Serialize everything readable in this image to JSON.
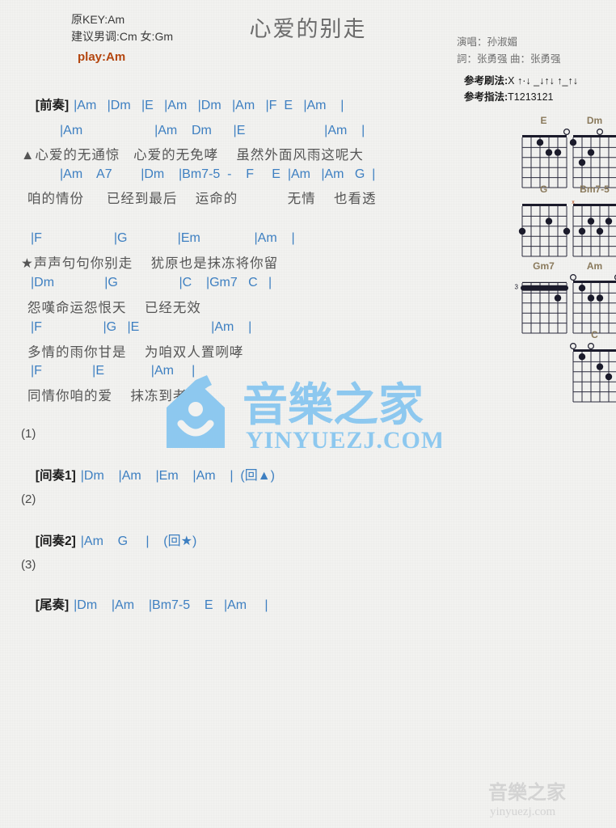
{
  "header": {
    "original_key": "原KEY:Am",
    "suggested_key": "建议男调:Cm 女:Gm",
    "play_key": "play:Am",
    "title": "心爱的别走",
    "singer": "演唱：孙淑媚",
    "writers": "詞：张勇强   曲：张勇强",
    "strum_label": "参考刷法:",
    "strum_value": "X ↑·↓ _↓↑↓ ↑_↑↓",
    "fingerstyle_label": "参考指法:",
    "fingerstyle_value": "T1213121"
  },
  "sections": {
    "intro": {
      "tag": "[前奏]",
      "chords": "|Am   |Dm   |E   |Am   |Dm   |Am   |F  E   |Am    |"
    },
    "verse1": {
      "chord_line_1": "|Am                    |Am    Dm      |E                      |Am    |",
      "lyric_line_1": "▲心爱的无通惊   心爱的无免哮    虽然外面风雨这呢大",
      "chord_line_2": "|Am    A7        |Dm    |Bm7-5  -    F     E  |Am   |Am   G  |",
      "lyric_line_2": "咱的情份     已经到最后    运命的           无情    也看透"
    },
    "chorus": {
      "chord_line_1": "|F                    |G              |Em               |Am    |",
      "lyric_line_1": "★声声句句你别走    犹原也是抹冻将你留",
      "chord_line_2": "|Dm              |G                 |C    |Gm7   C   |",
      "lyric_line_2": "怨嘆命运怨恨天    已经无效",
      "chord_line_3": "|F                 |G   |E                    |Am    |",
      "lyric_line_3": "多情的雨你甘是    为咱双人置咧哮",
      "chord_line_4": "|F              |E             |Am     |",
      "lyric_line_4": "同情你咱的爱    抹冻到老"
    },
    "interlude1": {
      "number": "(1)",
      "tag": "[间奏1]",
      "chords": "|Dm    |Am    |Em    |Am    |  (回▲)"
    },
    "interlude2": {
      "number": "(2)",
      "tag": "[间奏2]",
      "chords": "|Am    G     |    (回★)"
    },
    "outro": {
      "number": "(3)",
      "tag": "[尾奏]",
      "chords": "|Dm    |Am    |Bm7-5    E   |Am     |"
    }
  },
  "chord_diagrams": [
    {
      "name": "E",
      "open": [
        6
      ],
      "muted": [],
      "dots": [
        [
          3,
          1
        ],
        [
          5,
          2
        ],
        [
          4,
          2
        ]
      ],
      "barre": null,
      "fret_label": ""
    },
    {
      "name": "Dm",
      "open": [
        4
      ],
      "muted": [],
      "dots": [
        [
          1,
          1
        ],
        [
          3,
          2
        ],
        [
          2,
          3
        ]
      ],
      "barre": null,
      "fret_label": ""
    },
    {
      "name": "G",
      "open": [],
      "muted": [],
      "dots": [
        [
          4,
          2
        ],
        [
          6,
          3
        ],
        [
          1,
          3
        ]
      ],
      "barre": null,
      "fret_label": ""
    },
    {
      "name": "Bm7-5",
      "open": [],
      "muted": [
        6,
        1
      ],
      "dots": [
        [
          5,
          2
        ],
        [
          3,
          2
        ],
        [
          4,
          3
        ],
        [
          2,
          3
        ]
      ],
      "barre": null,
      "fret_label": ""
    },
    {
      "name": "Gm7",
      "open": [],
      "muted": [],
      "dots": [
        [
          5,
          2
        ]
      ],
      "barre": 1,
      "fret_label": "3"
    },
    {
      "name": "Am",
      "open": [
        6,
        1
      ],
      "muted": [],
      "dots": [
        [
          2,
          1
        ],
        [
          4,
          2
        ],
        [
          3,
          2
        ]
      ],
      "barre": null,
      "fret_label": ""
    },
    {
      "name": "C",
      "open": [
        3,
        1
      ],
      "muted": [
        6
      ],
      "dots": [
        [
          2,
          1
        ],
        [
          4,
          2
        ],
        [
          5,
          3
        ]
      ],
      "barre": null,
      "fret_label": ""
    }
  ],
  "watermark": {
    "brand_cn": "音樂之家",
    "brand_url": "YINYUEZJ.COM",
    "small_cn": "音樂之家",
    "small_url": "yinyuezj.com",
    "color": "#8dc8ef"
  }
}
